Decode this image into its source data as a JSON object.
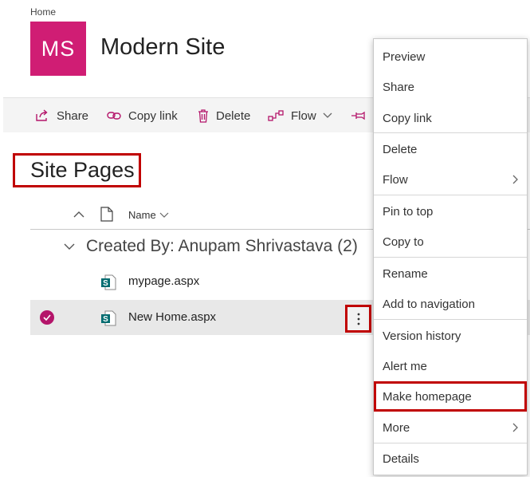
{
  "header": {
    "breadcrumb": "Home",
    "logo_initials": "MS",
    "site_title": "Modern Site"
  },
  "toolbar": {
    "share": "Share",
    "copy_link": "Copy link",
    "delete": "Delete",
    "flow": "Flow"
  },
  "library": {
    "title": "Site Pages",
    "name_column": "Name",
    "group_label": "Created By: Anupam Shrivastava (2)",
    "files": [
      {
        "name": "mypage.aspx",
        "selected": false
      },
      {
        "name": "New Home.aspx",
        "selected": true
      }
    ]
  },
  "context_menu": {
    "items": [
      {
        "label": "Preview"
      },
      {
        "label": "Share"
      },
      {
        "label": "Copy link"
      },
      {
        "label": "Delete"
      },
      {
        "label": "Flow",
        "submenu": true
      },
      {
        "label": "Pin to top"
      },
      {
        "label": "Copy to"
      },
      {
        "label": "Rename"
      },
      {
        "label": "Add to navigation"
      },
      {
        "label": "Version history"
      },
      {
        "label": "Alert me"
      },
      {
        "label": "Make homepage",
        "highlighted": true
      },
      {
        "label": "More",
        "submenu": true
      },
      {
        "label": "Details"
      }
    ]
  },
  "colors": {
    "brand": "#d01d74",
    "highlight_box": "#c00000",
    "check": "#b4156a"
  }
}
